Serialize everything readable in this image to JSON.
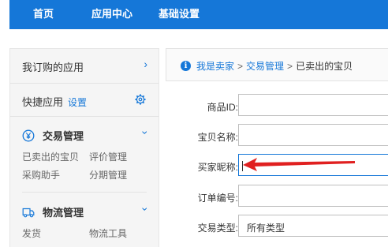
{
  "topnav": {
    "items": [
      "首页",
      "应用中心",
      "基础设置"
    ]
  },
  "sidebar": {
    "my_apps": "我订购的应用",
    "quick_apps": "快捷应用",
    "settings_link": "设置",
    "groups": [
      {
        "title": "交易管理",
        "icon": "yen-circle-icon",
        "links": [
          "已卖出的宝贝",
          "评价管理",
          "采购助手",
          "分期管理"
        ]
      },
      {
        "title": "物流管理",
        "icon": "truck-icon",
        "links": [
          "发货",
          "物流工具"
        ]
      }
    ]
  },
  "breadcrumb": {
    "items": [
      "我是卖家",
      "交易管理"
    ],
    "separator": ">",
    "current": "已卖出的宝贝"
  },
  "form": {
    "fields": [
      {
        "label": "商品ID:",
        "value": ""
      },
      {
        "label": "宝贝名称:",
        "value": ""
      },
      {
        "label": "买家昵称:",
        "value": ""
      },
      {
        "label": "订单编号:",
        "value": ""
      },
      {
        "label": "交易类型:",
        "value": "所有类型"
      }
    ]
  },
  "colors": {
    "brand_blue": "#1577d8",
    "annotation_red": "#e02020"
  }
}
